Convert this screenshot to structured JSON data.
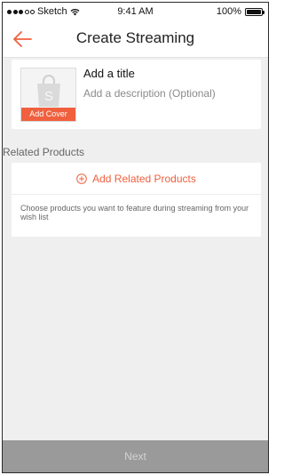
{
  "status_bar": {
    "carrier": "Sketch",
    "time": "9:41 AM",
    "battery": "100%"
  },
  "nav": {
    "title": "Create Streaming",
    "back_icon": "arrow-left-icon"
  },
  "cover": {
    "button_label": "Add Cover",
    "placeholder_icon": "shopping-bag-icon",
    "bag_letter": "S"
  },
  "form": {
    "title_placeholder": "Add a title",
    "description_placeholder": "Add a description (Optional)"
  },
  "related_products": {
    "section_label": "Related Products",
    "add_label": "Add Related Products",
    "add_icon": "plus-circle-icon",
    "hint": "Choose products you want to feature during streaming from your wish list"
  },
  "footer": {
    "next_label": "Next"
  },
  "colors": {
    "accent": "#f0603e",
    "background": "#efefef",
    "bottom_bar": "#9a9a9a"
  }
}
